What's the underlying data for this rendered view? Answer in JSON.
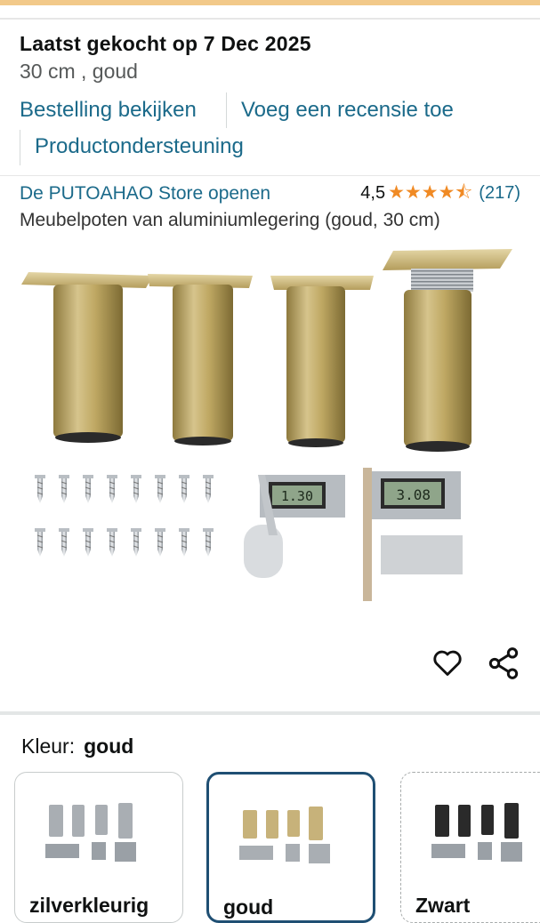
{
  "order": {
    "title": "Laatst gekocht op 7 Dec 2025",
    "variant": "30 cm , goud",
    "view_order": "Bestelling bekijken",
    "add_review": "Voeg een recensie toe",
    "support": "Productondersteuning"
  },
  "product": {
    "store_link": "De PUTOAHAO Store openen",
    "rating": "4,5",
    "rating_stars": 4.5,
    "review_count": "(217)",
    "name": "Meubelpoten van aluminiumlegering (goud, 30 cm)",
    "caliper_readout_1": "1.30",
    "caliper_readout_2": "3.08"
  },
  "actions": {
    "favorite_icon": "heart-icon",
    "share_icon": "share-icon"
  },
  "color_selector": {
    "label": "Kleur:",
    "selected": "goud",
    "options": [
      {
        "label": "zilverkleurig",
        "color": "#a9aeb3"
      },
      {
        "label": "goud",
        "color": "#c7b27a"
      },
      {
        "label": "Zwart",
        "color": "#2a2a2a"
      }
    ]
  },
  "colors": {
    "link": "#1b6a8a",
    "star": "#f08a24",
    "selected_border": "#1f4f73"
  }
}
